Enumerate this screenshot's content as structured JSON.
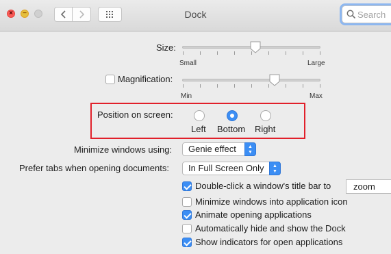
{
  "window": {
    "title": "Dock",
    "search_placeholder": "Search"
  },
  "size": {
    "label": "Size:",
    "min_label": "Small",
    "max_label": "Large",
    "value_fraction": 0.53
  },
  "magnification": {
    "label": "Magnification:",
    "checked": false,
    "min_label": "Min",
    "max_label": "Max",
    "value_fraction": 0.67
  },
  "position": {
    "label": "Position on screen:",
    "options": [
      {
        "label": "Left",
        "selected": false
      },
      {
        "label": "Bottom",
        "selected": true
      },
      {
        "label": "Right",
        "selected": false
      }
    ]
  },
  "minimize": {
    "label": "Minimize windows using:",
    "value": "Genie effect"
  },
  "prefer_tabs": {
    "label": "Prefer tabs when opening documents:",
    "value": "In Full Screen Only"
  },
  "options": [
    {
      "label": "Double-click a window's title bar to",
      "checked": true,
      "field_value": "zoom"
    },
    {
      "label": "Minimize windows into application icon",
      "checked": false
    },
    {
      "label": "Animate opening applications",
      "checked": true
    },
    {
      "label": "Automatically hide and show the Dock",
      "checked": false
    },
    {
      "label": "Show indicators for open applications",
      "checked": true
    }
  ],
  "colors": {
    "accent": "#3c8ef4",
    "highlight_box": "#e1202a"
  },
  "icons": {
    "close": "close-icon",
    "minimize": "minimize-icon",
    "zoom": "zoom-icon",
    "back": "chevron-left-icon",
    "forward": "chevron-right-icon",
    "grid": "grid-icon",
    "search": "search-icon"
  }
}
